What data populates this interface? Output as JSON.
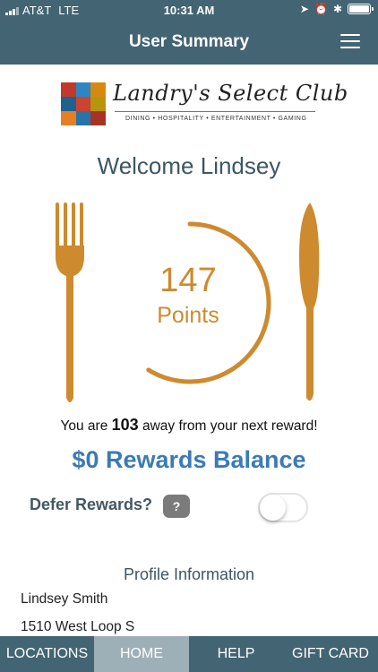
{
  "status_bar": {
    "carrier": "AT&T",
    "network": "LTE",
    "time": "10:31 AM"
  },
  "header": {
    "title": "User Summary",
    "menu_icon": "hamburger-icon"
  },
  "logo": {
    "script_text": "Landry's Select Club",
    "tagline": "DINING • HOSPITALITY • ENTERTAINMENT • GAMING"
  },
  "welcome": "Welcome Lindsey",
  "points": {
    "value": "147",
    "label": "Points",
    "progress_fraction": 0.588
  },
  "reward": {
    "prefix": "You are ",
    "amount": "103",
    "suffix": " away from your next reward!"
  },
  "balance": "$0 Rewards Balance",
  "defer": {
    "label": "Defer Rewards?",
    "help_label": "?",
    "enabled": false
  },
  "profile": {
    "title": "Profile Information",
    "name": "Lindsey Smith",
    "address": "1510 West Loop S"
  },
  "tabs": [
    {
      "label": "LOCATIONS",
      "active": false
    },
    {
      "label": "HOME",
      "active": true
    },
    {
      "label": "HELP",
      "active": false
    },
    {
      "label": "GIFT CARD",
      "active": false
    }
  ],
  "colors": {
    "nav": "#436473",
    "accent_gold": "#cd8a2e",
    "balance_blue": "#3b7bb5",
    "active_tab": "#9db0b8"
  }
}
